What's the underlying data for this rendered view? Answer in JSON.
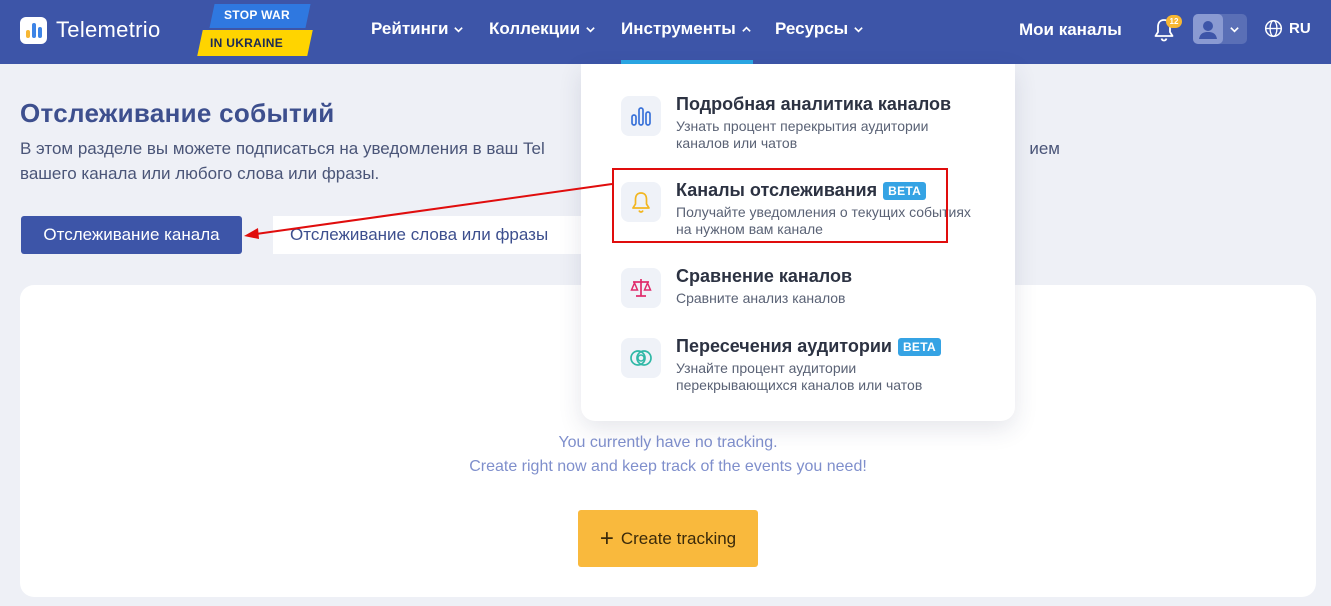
{
  "navbar": {
    "logo_text": "Telemetrio",
    "stopwar_top": "STOP WAR",
    "stopwar_bottom": "IN UKRAINE",
    "menu": [
      {
        "label": "Рейтинги"
      },
      {
        "label": "Коллекции"
      },
      {
        "label": "Инструменты"
      },
      {
        "label": "Ресурсы"
      }
    ],
    "my_channels": "Мои каналы",
    "notifications_count": "12",
    "language": "RU"
  },
  "page": {
    "title": "Отслеживание событий",
    "description_left": "В этом разделе вы можете подписаться на уведомления в ваш Tel",
    "description_right": "ием",
    "description_line2": "вашего канала или любого слова или фразы.",
    "tab_channel": "Отслеживание канала",
    "tab_word": "Отслеживание слова или фразы",
    "empty_line1": "You currently have no tracking.",
    "empty_line2": "Create right now and keep track of the events you need!",
    "create_button": "Create tracking"
  },
  "dropdown": {
    "items": [
      {
        "title": "Подробная аналитика каналов",
        "desc": "Узнать процент перекрытия аудитории каналов или чатов",
        "beta": ""
      },
      {
        "title": "Каналы отслеживания",
        "desc": "Получайте уведомления о текущих событиях на нужном вам канале",
        "beta": "BETA"
      },
      {
        "title": "Сравнение каналов",
        "desc": "Сравните анализ каналов",
        "beta": ""
      },
      {
        "title": "Пересечения аудитории",
        "desc": "Узнайте процент аудитории перекрывающихся каналов или чатов",
        "beta": "BETA"
      }
    ]
  },
  "colors": {
    "navbar": "#3d55a8",
    "accent_blue": "#2aa8e6",
    "create_button": "#f9b93d",
    "highlight_red": "#e00d0d"
  }
}
